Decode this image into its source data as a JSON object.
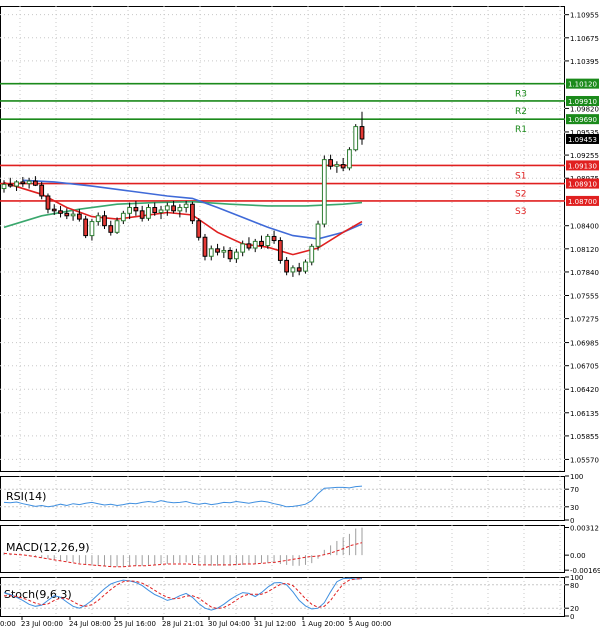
{
  "colors": {
    "background": "#ffffff",
    "grid": "#c8c8c8",
    "bull_candle": "#2e7d32",
    "bear_candle": "#e53935",
    "resistance": "#1b8a1b",
    "support": "#e02020",
    "ma_fast": "#e02020",
    "ma_mid": "#3f6ad8",
    "ma_slow": "#3aa76d",
    "rsi_line": "#3f8fe0",
    "macd_hist": "#9e9e9e",
    "macd_signal": "#e02020",
    "stoch_main": "#3f8fe0",
    "stoch_signal": "#e02020"
  },
  "chart_data": [
    {
      "type": "candlestick",
      "name": "price",
      "grid": true,
      "ylim": [
        1.0543,
        1.1106
      ],
      "y_ticks": [
        "1.10955",
        "1.10675",
        "1.10395",
        "1.09820",
        "1.09535",
        "1.09255",
        "1.08975",
        "1.08400",
        "1.08120",
        "1.07840",
        "1.07555",
        "1.07275",
        "1.06985",
        "1.06705",
        "1.06420",
        "1.06135",
        "1.05855",
        "1.05570"
      ],
      "x_ticks": [
        "23 Jul 00:00",
        "24 Jul 08:00",
        "25 Jul 16:00",
        "28 Jul 21:01",
        "30 Jul 04:00",
        "31 Jul 12:00",
        "1 Aug 20:00",
        "5 Aug 00:00"
      ],
      "x_tick_partial": "0:00",
      "current_price": "1.09453",
      "levels": [
        {
          "label": "R3",
          "value": 1.1012,
          "price_label": "1.10120",
          "kind": "resistance"
        },
        {
          "label": "R2",
          "value": 1.0991,
          "price_label": "1.09910",
          "kind": "resistance"
        },
        {
          "label": "R1",
          "value": 1.0969,
          "price_label": "1.09690",
          "kind": "resistance"
        },
        {
          "label": "S1",
          "value": 1.0913,
          "price_label": "1.09130",
          "kind": "support"
        },
        {
          "label": "S2",
          "value": 1.0891,
          "price_label": "1.08910",
          "kind": "support"
        },
        {
          "label": "S3",
          "value": 1.087,
          "price_label": "1.08700",
          "kind": "support"
        }
      ],
      "candles": [
        [
          1.0885,
          1.0895,
          1.088,
          1.089
        ],
        [
          1.089,
          1.0898,
          1.0886,
          1.0888
        ],
        [
          1.0888,
          1.0895,
          1.0882,
          1.0893
        ],
        [
          1.0893,
          1.0899,
          1.0887,
          1.0891
        ],
        [
          1.0891,
          1.0898,
          1.0885,
          1.0894
        ],
        [
          1.0894,
          1.09,
          1.0888,
          1.0889
        ],
        [
          1.0889,
          1.0893,
          1.0872,
          1.0876
        ],
        [
          1.0876,
          1.0879,
          1.0855,
          1.086
        ],
        [
          1.086,
          1.0866,
          1.0853,
          1.0858
        ],
        [
          1.0858,
          1.0864,
          1.085,
          1.0855
        ],
        [
          1.0855,
          1.0861,
          1.0848,
          1.0852
        ],
        [
          1.0852,
          1.0858,
          1.0846,
          1.0854
        ],
        [
          1.0854,
          1.086,
          1.0845,
          1.0848
        ],
        [
          1.0848,
          1.0852,
          1.0825,
          1.0828
        ],
        [
          1.0828,
          1.0848,
          1.0822,
          1.0845
        ],
        [
          1.0845,
          1.0856,
          1.084,
          1.0852
        ],
        [
          1.0852,
          1.0858,
          1.0836,
          1.084
        ],
        [
          1.084,
          1.0846,
          1.0828,
          1.0832
        ],
        [
          1.0832,
          1.085,
          1.083,
          1.0846
        ],
        [
          1.0846,
          1.0858,
          1.0842,
          1.0855
        ],
        [
          1.0855,
          1.0868,
          1.0848,
          1.0862
        ],
        [
          1.0862,
          1.087,
          1.0852,
          1.0858
        ],
        [
          1.0858,
          1.0864,
          1.0845,
          1.0849
        ],
        [
          1.0849,
          1.0866,
          1.0846,
          1.0862
        ],
        [
          1.0862,
          1.0868,
          1.0852,
          1.0856
        ],
        [
          1.0856,
          1.0864,
          1.0848,
          1.0859
        ],
        [
          1.0859,
          1.0868,
          1.0852,
          1.0864
        ],
        [
          1.0864,
          1.087,
          1.0855,
          1.0858
        ],
        [
          1.0858,
          1.0866,
          1.085,
          1.0862
        ],
        [
          1.0862,
          1.087,
          1.0856,
          1.0866
        ],
        [
          1.0866,
          1.0869,
          1.0842,
          1.0846
        ],
        [
          1.0846,
          1.0849,
          1.0822,
          1.0826
        ],
        [
          1.0826,
          1.083,
          1.0798,
          1.0803
        ],
        [
          1.0803,
          1.0816,
          1.0798,
          1.0812
        ],
        [
          1.0812,
          1.0818,
          1.0804,
          1.0808
        ],
        [
          1.0808,
          1.0815,
          1.0801,
          1.081
        ],
        [
          1.081,
          1.0814,
          1.0796,
          1.08
        ],
        [
          1.08,
          1.0812,
          1.0795,
          1.0808
        ],
        [
          1.0808,
          1.0822,
          1.0803,
          1.0818
        ],
        [
          1.0818,
          1.0826,
          1.081,
          1.0813
        ],
        [
          1.0813,
          1.0824,
          1.0808,
          1.0821
        ],
        [
          1.0821,
          1.0828,
          1.0812,
          1.0816
        ],
        [
          1.0816,
          1.083,
          1.0812,
          1.0827
        ],
        [
          1.0827,
          1.0834,
          1.0818,
          1.0822
        ],
        [
          1.0822,
          1.0826,
          1.0794,
          1.0798
        ],
        [
          1.0798,
          1.0802,
          1.078,
          1.0784
        ],
        [
          1.0784,
          1.0792,
          1.0778,
          1.0789
        ],
        [
          1.0789,
          1.0795,
          1.078,
          1.0785
        ],
        [
          1.0785,
          1.0799,
          1.0782,
          1.0796
        ],
        [
          1.0796,
          1.0818,
          1.0792,
          1.0815
        ],
        [
          1.0815,
          1.0846,
          1.081,
          1.0842
        ],
        [
          1.0842,
          1.0925,
          1.0838,
          1.092
        ],
        [
          1.092,
          1.0926,
          1.0908,
          1.0912
        ],
        [
          1.0912,
          1.0918,
          1.0904,
          1.0914
        ],
        [
          1.0914,
          1.0922,
          1.0906,
          1.091
        ],
        [
          1.091,
          1.0935,
          1.0907,
          1.0932
        ],
        [
          1.0932,
          1.0963,
          1.093,
          1.096
        ],
        [
          1.096,
          1.0978,
          1.0938,
          1.0945
        ]
      ],
      "ma_fast_ma": [
        [
          0,
          1.0892
        ],
        [
          6,
          1.0878
        ],
        [
          10,
          1.0862
        ],
        [
          14,
          1.0851
        ],
        [
          18,
          1.0848
        ],
        [
          22,
          1.0852
        ],
        [
          26,
          1.0856
        ],
        [
          30,
          1.0853
        ],
        [
          34,
          1.0832
        ],
        [
          38,
          1.0818
        ],
        [
          42,
          1.0814
        ],
        [
          46,
          1.0805
        ],
        [
          50,
          1.0813
        ],
        [
          54,
          1.0832
        ],
        [
          57,
          1.0845
        ]
      ],
      "ma_mid_ma": [
        [
          3,
          1.0895
        ],
        [
          8,
          1.0893
        ],
        [
          14,
          1.0888
        ],
        [
          20,
          1.0882
        ],
        [
          26,
          1.0876
        ],
        [
          30,
          1.0873
        ],
        [
          34,
          1.0862
        ],
        [
          38,
          1.085
        ],
        [
          42,
          1.0838
        ],
        [
          46,
          1.0828
        ],
        [
          50,
          1.0824
        ],
        [
          54,
          1.0832
        ],
        [
          57,
          1.0842
        ]
      ],
      "ma_slow_ma": [
        [
          0,
          1.0838
        ],
        [
          6,
          1.0852
        ],
        [
          12,
          1.086
        ],
        [
          18,
          1.0866
        ],
        [
          24,
          1.0868
        ],
        [
          30,
          1.0869
        ],
        [
          36,
          1.0866
        ],
        [
          42,
          1.0864
        ],
        [
          48,
          1.0864
        ],
        [
          54,
          1.0866
        ],
        [
          57,
          1.0868
        ]
      ]
    },
    {
      "type": "line",
      "name": "RSI(14)",
      "label": "RSI(14)",
      "ylim": [
        0,
        100
      ],
      "y_ticks": [
        "100",
        "70",
        "30",
        "0"
      ],
      "values": [
        40,
        39,
        41,
        37,
        34,
        31,
        33,
        30,
        32,
        36,
        33,
        37,
        35,
        38,
        40,
        37,
        34,
        36,
        33,
        35,
        38,
        37,
        40,
        42,
        40,
        44,
        41,
        39,
        40,
        42,
        38,
        36,
        38,
        35,
        37,
        40,
        39,
        42,
        40,
        38,
        41,
        43,
        41,
        37,
        34,
        30,
        31,
        33,
        36,
        44,
        60,
        72,
        73,
        74,
        74,
        73,
        76,
        77
      ]
    },
    {
      "type": "bar",
      "name": "MACD(12,26,9)",
      "label": "MACD(12,26,9)",
      "ylim": [
        -0.0019,
        0.0034
      ],
      "y_ticks": [
        "0.00312",
        "0.00",
        "-0.001692"
      ],
      "histogram": [
        0.0003,
        0.0002,
        0.0001,
        0.0,
        -0.0001,
        -0.0002,
        -0.0003,
        -0.0004,
        -0.0005,
        -0.0006,
        -0.0007,
        -0.0008,
        -0.0009,
        -0.001,
        -0.0011,
        -0.0012,
        -0.0012,
        -0.0013,
        -0.0013,
        -0.0013,
        -0.0013,
        -0.0012,
        -0.0012,
        -0.0011,
        -0.0011,
        -0.001,
        -0.001,
        -0.0009,
        -0.0009,
        -0.0008,
        -0.0009,
        -0.001,
        -0.0011,
        -0.0012,
        -0.0012,
        -0.0012,
        -0.0012,
        -0.0011,
        -0.0011,
        -0.001,
        -0.001,
        -0.0009,
        -0.0009,
        -0.0009,
        -0.001,
        -0.0011,
        -0.0012,
        -0.0012,
        -0.0011,
        -0.0009,
        -0.0004,
        0.0006,
        0.0011,
        0.0016,
        0.002,
        0.0024,
        0.003,
        0.0031
      ],
      "signal": [
        0.0002,
        0.0001,
        0.0,
        -0.0002,
        -0.0004,
        -0.0006,
        -0.0008,
        -0.001,
        -0.0011,
        -0.0012,
        -0.0013,
        -0.0013,
        -0.0012,
        -0.0012,
        -0.0011,
        -0.001,
        -0.001,
        -0.001,
        -0.0011,
        -0.0011,
        -0.0011,
        -0.0011,
        -0.001,
        -0.001,
        -0.0009,
        -0.0008,
        -0.0006,
        -0.0004,
        -0.0002,
        -0.0001,
        0.0002,
        0.0006,
        0.0011,
        0.0014
      ]
    },
    {
      "type": "line",
      "name": "Stoch(9,6,3)",
      "label": "Stoch(9,6,3)",
      "ylim": [
        0,
        100
      ],
      "y_ticks": [
        "100",
        "80",
        "20",
        "0"
      ],
      "main": [
        60,
        55,
        48,
        40,
        30,
        25,
        28,
        40,
        52,
        48,
        36,
        25,
        20,
        28,
        40,
        55,
        70,
        82,
        88,
        92,
        90,
        86,
        78,
        66,
        55,
        48,
        40,
        44,
        52,
        58,
        48,
        32,
        20,
        15,
        20,
        30,
        42,
        52,
        60,
        58,
        50,
        60,
        74,
        85,
        86,
        80,
        62,
        40,
        26,
        18,
        20,
        34,
        62,
        88,
        96,
        97,
        95,
        96
      ],
      "signal": [
        52,
        52,
        50,
        46,
        40,
        33,
        29,
        31,
        40,
        46,
        45,
        37,
        28,
        25,
        29,
        40,
        54,
        68,
        80,
        88,
        90,
        89,
        84,
        76,
        66,
        56,
        48,
        44,
        46,
        51,
        52,
        46,
        34,
        23,
        19,
        22,
        30,
        41,
        51,
        56,
        56,
        56,
        62,
        72,
        81,
        84,
        78,
        62,
        44,
        30,
        22,
        25,
        40,
        62,
        82,
        92,
        95,
        96
      ]
    }
  ]
}
